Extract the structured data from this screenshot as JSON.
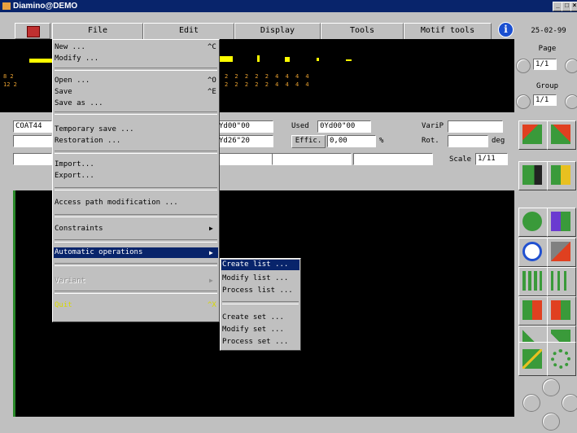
{
  "window": {
    "title": "Diamino@DEMO"
  },
  "menubar": {
    "file": "File",
    "edit": "Edit",
    "display": "Display",
    "tools": "Tools",
    "motif_tools": "Motif tools"
  },
  "date": "25-02-99",
  "right_panel": {
    "page_label": "Page",
    "page_value": "1/1",
    "group_label": "Group",
    "group_value": "1/1"
  },
  "preview": {
    "row1_left": "8 2",
    "row2_left": "12 2",
    "row1_right": "2 2 2 2 2 4 4 4 4",
    "row2_right": "2 2 2 2 2 4 4 4 4"
  },
  "info": {
    "name": "COAT44",
    "yd1": "Yd00\"00",
    "used_label": "Used",
    "used_value": "0Yd00\"00",
    "varip_label": "VariP",
    "yd2": "Yd26\"20",
    "effic_label": "Effic.",
    "effic_value": "0,00",
    "pct": "%",
    "rot_label": "Rot.",
    "deg": "deg",
    "scale_label": "Scale",
    "scale_value": "1/11"
  },
  "file_menu": {
    "new": "New ...",
    "new_sc": "^C",
    "modify": "Modify ...",
    "open": "Open ...",
    "open_sc": "^O",
    "save": "Save",
    "save_sc": "^E",
    "save_as": "Save as ...",
    "temporary_save": "Temporary save ...",
    "restoration": "Restoration ...",
    "import": "Import...",
    "export": "Export...",
    "access_path": "Access path modification ...",
    "constraints": "Constraints",
    "automatic_operations": "Automatic operations",
    "variant": "Variant",
    "quit": "Quit",
    "quit_sc": "^X"
  },
  "submenu": {
    "create_list": "Create list ...",
    "modify_list": "Modify list ...",
    "process_list": "Process list ...",
    "create_set": "Create set ...",
    "modify_set": "Modify set ...",
    "process_set": "Process set ..."
  },
  "colors": {
    "menu_highlight": "#08246b",
    "quit_text": "#d8d800",
    "title_bg": "#08246b"
  }
}
